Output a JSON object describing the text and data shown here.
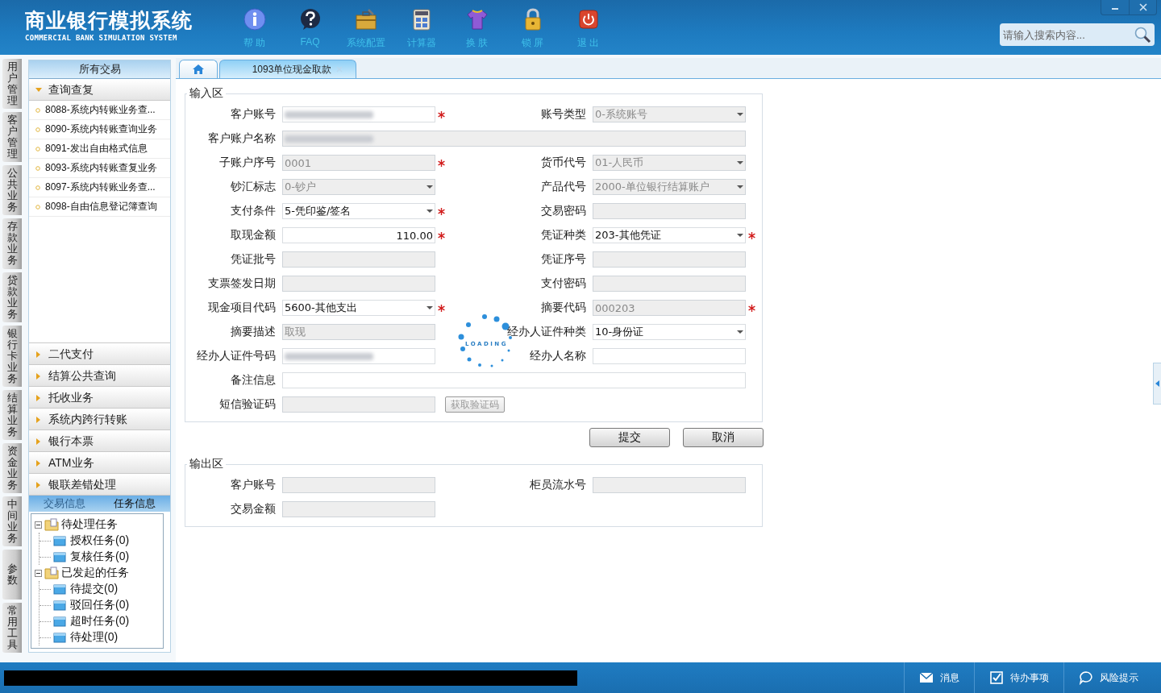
{
  "header": {
    "title": "商业银行模拟系统",
    "subtitle": "COMMERCIAL BANK SIMULATION SYSTEM",
    "toolbar": [
      {
        "label": "帮 助"
      },
      {
        "label": "FAQ"
      },
      {
        "label": "系统配置"
      },
      {
        "label": "计算器"
      },
      {
        "label": "换 肤"
      },
      {
        "label": "锁 屏"
      },
      {
        "label": "退 出"
      }
    ],
    "search": {
      "placeholder": "请输入搜索内容..."
    }
  },
  "left_tabs": [
    "用户管理",
    "客户管理",
    "公共业务",
    "存款业务",
    "贷款业务",
    "银行卡业务",
    "结算业务",
    "资金业务",
    "中间业务",
    "参数",
    "常用工具"
  ],
  "sidebar": {
    "title": "所有交易",
    "groups": [
      {
        "label": "查询查复",
        "expanded": true,
        "items": [
          "8088-系统内转账业务查...",
          "8090-系统内转账查询业务",
          "8091-发出自由格式信息",
          "8093-系统内转账查复业务",
          "8097-系统内转账业务查...",
          "8098-自由信息登记簿查询"
        ]
      },
      {
        "label": "二代支付",
        "expanded": false
      },
      {
        "label": "结算公共查询",
        "expanded": false
      },
      {
        "label": "托收业务",
        "expanded": false
      },
      {
        "label": "系统内跨行转账",
        "expanded": false
      },
      {
        "label": "银行本票",
        "expanded": false
      },
      {
        "label": "ATM业务",
        "expanded": false
      },
      {
        "label": "银联差错处理",
        "expanded": false
      }
    ]
  },
  "info_tabs": [
    {
      "label": "交易信息",
      "selected": false
    },
    {
      "label": "任务信息",
      "selected": true
    }
  ],
  "task_tree": [
    {
      "label": "待处理任务",
      "expanded": true,
      "children": [
        {
          "label": "授权任务(0)"
        },
        {
          "label": "复核任务(0)"
        }
      ]
    },
    {
      "label": "已发起的任务",
      "expanded": true,
      "children": [
        {
          "label": "待提交(0)"
        },
        {
          "label": "驳回任务(0)"
        },
        {
          "label": "超时任务(0)"
        },
        {
          "label": "待处理(0)"
        }
      ]
    }
  ],
  "tabs": [
    {
      "kind": "home",
      "selected": false
    },
    {
      "kind": "page",
      "label": "1093单位现金取款",
      "selected": true
    }
  ],
  "input_section": {
    "title": "输入区",
    "rows": [
      [
        {
          "label": "客户账号",
          "kind": "text",
          "redacted": true,
          "disabled": false,
          "required": true
        },
        {
          "label": "账号类型",
          "kind": "select",
          "value": "0-系统账号",
          "disabled": true,
          "required": false
        }
      ],
      [
        {
          "label": "客户账户名称",
          "kind": "wide",
          "redacted": true,
          "disabled": true,
          "required": false
        }
      ],
      [
        {
          "label": "子账户序号",
          "kind": "text",
          "value": "0001",
          "disabled": true,
          "required": true
        },
        {
          "label": "货币代号",
          "kind": "select",
          "value": "01-人民币",
          "disabled": true,
          "required": false
        }
      ],
      [
        {
          "label": "钞汇标志",
          "kind": "select",
          "value": "0-钞户",
          "disabled": true,
          "required": false
        },
        {
          "label": "产品代号",
          "kind": "select",
          "value": "2000-单位银行结算账户",
          "disabled": true,
          "required": false
        }
      ],
      [
        {
          "label": "支付条件",
          "kind": "select",
          "value": "5-凭印鉴/签名",
          "disabled": false,
          "required": true
        },
        {
          "label": "交易密码",
          "kind": "text",
          "disabled": true,
          "required": false
        }
      ],
      [
        {
          "label": "取现金额",
          "kind": "amount",
          "value": "110.00",
          "disabled": false,
          "required": true
        },
        {
          "label": "凭证种类",
          "kind": "select",
          "value": "203-其他凭证",
          "disabled": false,
          "required": true
        }
      ],
      [
        {
          "label": "凭证批号",
          "kind": "text",
          "disabled": true,
          "required": false
        },
        {
          "label": "凭证序号",
          "kind": "text",
          "disabled": true,
          "required": false
        }
      ],
      [
        {
          "label": "支票签发日期",
          "kind": "text",
          "disabled": true,
          "required": false
        },
        {
          "label": "支付密码",
          "kind": "text",
          "disabled": true,
          "required": false
        }
      ],
      [
        {
          "label": "现金项目代码",
          "kind": "select",
          "value": "5600-其他支出",
          "disabled": false,
          "required": true
        },
        {
          "label": "摘要代码",
          "kind": "text",
          "value": "000203",
          "disabled": true,
          "required": true
        }
      ],
      [
        {
          "label": "摘要描述",
          "kind": "text",
          "value": "取现",
          "disabled": true,
          "required": false
        },
        {
          "label": "经办人证件种类",
          "kind": "select",
          "value": "10-身份证",
          "disabled": false,
          "required": false
        }
      ],
      [
        {
          "label": "经办人证件号码",
          "kind": "text",
          "redacted": true,
          "disabled": false,
          "required": false
        },
        {
          "label": "经办人名称",
          "kind": "text",
          "disabled": false,
          "required": false
        }
      ],
      [
        {
          "label": "备注信息",
          "kind": "wide",
          "disabled": false,
          "required": false
        }
      ],
      [
        {
          "label": "短信验证码",
          "kind": "text",
          "disabled": true,
          "required": false,
          "button": {
            "label": "获取验证码",
            "disabled": true
          }
        }
      ]
    ]
  },
  "loading": {
    "text": "LOADING"
  },
  "buttons": [
    "提交",
    "取消"
  ],
  "output_section": {
    "title": "输出区",
    "rows": [
      [
        {
          "label": "客户账号",
          "kind": "text",
          "disabled": true,
          "required": false
        },
        {
          "label": "柜员流水号",
          "kind": "text",
          "disabled": true,
          "required": false
        }
      ],
      [
        {
          "label": "交易金额",
          "kind": "text",
          "disabled": true,
          "required": false
        }
      ]
    ]
  },
  "status_bar": {
    "items": [
      {
        "label": "消息"
      },
      {
        "label": "待办事项"
      },
      {
        "label": "风险提示"
      }
    ]
  }
}
